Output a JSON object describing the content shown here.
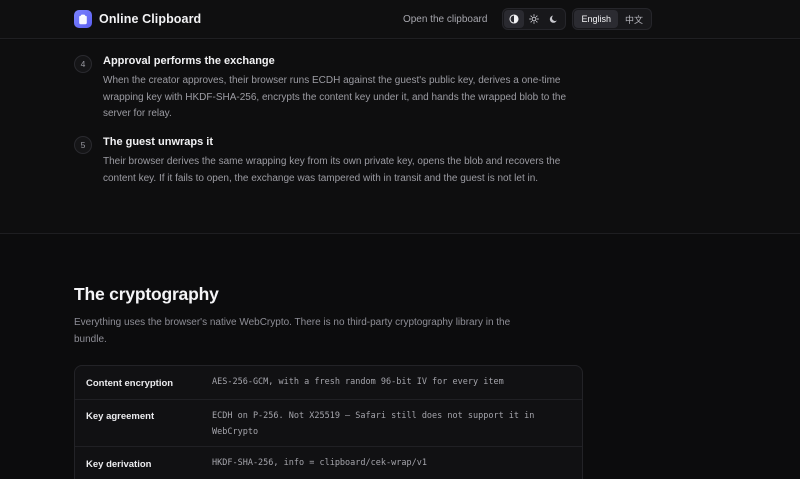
{
  "header": {
    "brand": "Online Clipboard",
    "open_link": "Open the clipboard",
    "theme_icons": [
      "contrast-icon",
      "sun-icon",
      "moon-icon"
    ],
    "languages": [
      "English",
      "中文"
    ],
    "active_language": "English",
    "accent": "#6b6ff5"
  },
  "steps": [
    {
      "num": "4",
      "title": "Approval performs the exchange",
      "body": "When the creator approves, their browser runs ECDH against the guest's public key, derives a one-time wrapping key with HKDF-SHA-256, encrypts the content key under it, and hands the wrapped blob to the server for relay."
    },
    {
      "num": "5",
      "title": "The guest unwraps it",
      "body": "Their browser derives the same wrapping key from its own private key, opens the blob and recovers the content key. If it fails to open, the exchange was tampered with in transit and the guest is not let in."
    }
  ],
  "crypto": {
    "title": "The cryptography",
    "lead": "Everything uses the browser's native WebCrypto. There is no third-party cryptography library in the bundle.",
    "rows": [
      {
        "label": "Content encryption",
        "value": "AES-256-GCM, with a fresh random 96-bit IV for every item"
      },
      {
        "label": "Key agreement",
        "value": "ECDH on P-256. Not X25519 — Safari still does not support it in WebCrypto"
      },
      {
        "label": "Key derivation",
        "value": "HKDF-SHA-256, info = clipboard/cek-wrap/v1"
      }
    ]
  }
}
